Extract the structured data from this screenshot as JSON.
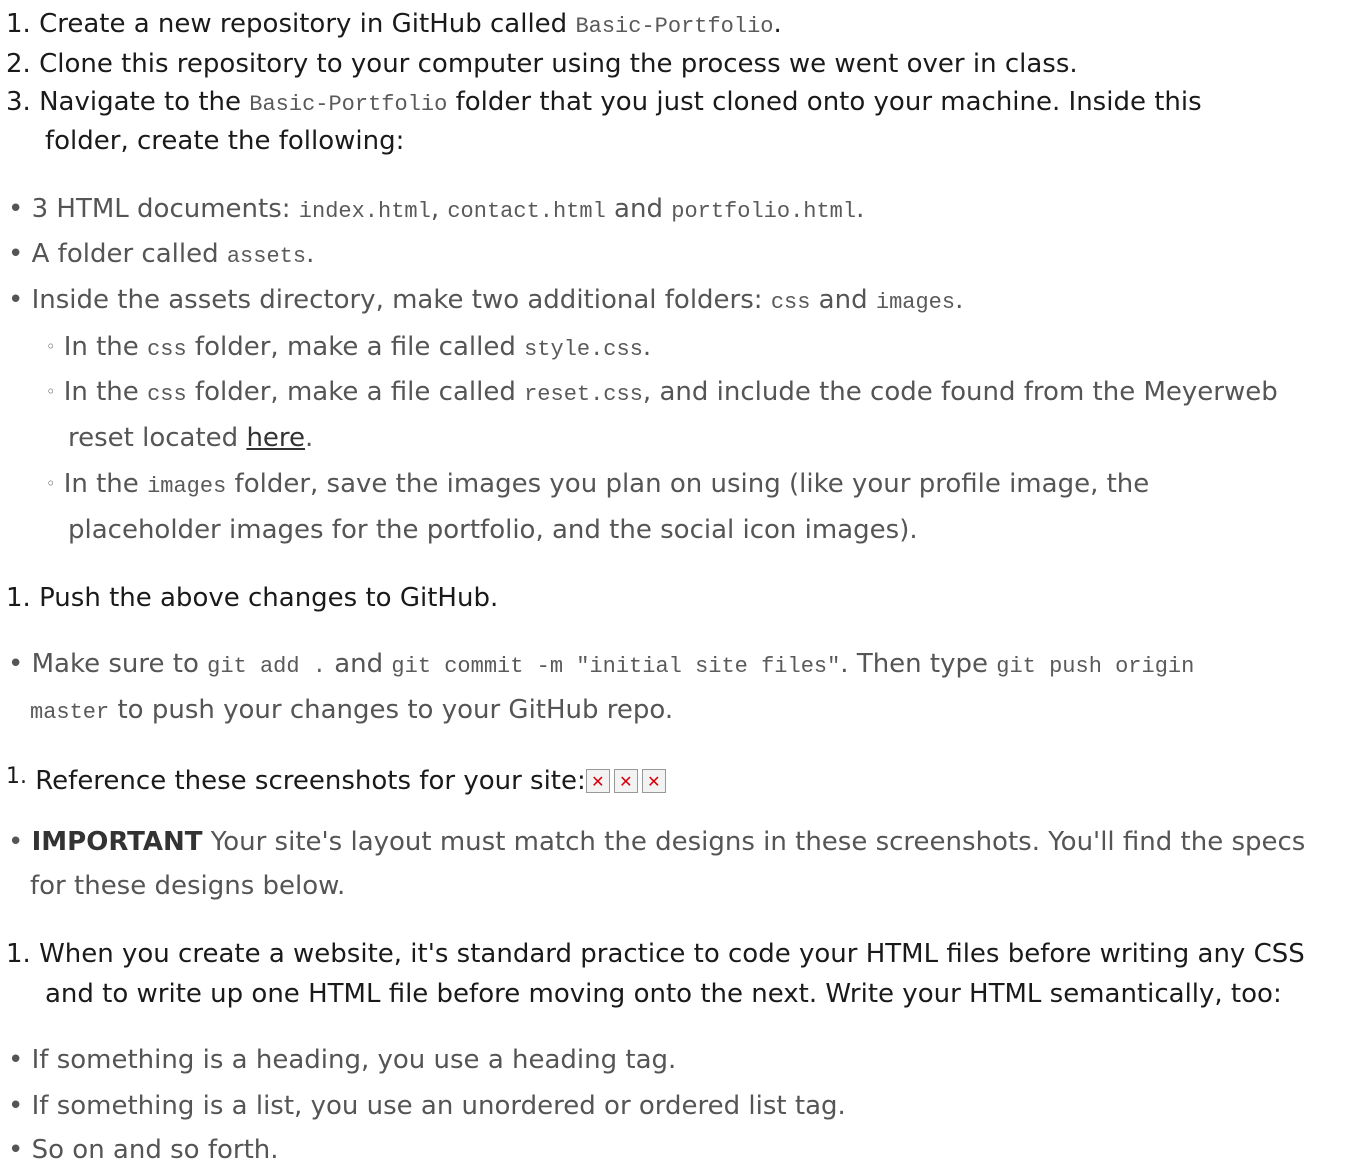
{
  "steps_a": [
    {
      "num": "1.",
      "before": "Create a new repository in GitHub called ",
      "code": "Basic-Portfolio",
      "after": "."
    },
    {
      "num": "2.",
      "text": "Clone this repository to your computer using the process we went over in class."
    },
    {
      "num": "3.",
      "before": "Navigate to the ",
      "code": "Basic-Portfolio",
      "after": " folder that you just cloned onto your machine. Inside this",
      "line2": "folder, create the following:"
    }
  ],
  "files_list": [
    {
      "before": "3 HTML documents: ",
      "code1": "index.html",
      "sep1": ", ",
      "code2": "contact.html",
      "sep2": " and ",
      "code3": "portfolio.html",
      "after": "."
    },
    {
      "before": "A folder called ",
      "code": "assets",
      "after": "."
    },
    {
      "before": "Inside the assets directory, make two additional folders: ",
      "code1": "css",
      "sep": " and ",
      "code2": "images",
      "after": "."
    }
  ],
  "sub_list": [
    {
      "before": "In the ",
      "code1": "css",
      "mid": " folder, make a file called ",
      "code2": "style.css",
      "after": "."
    },
    {
      "before": "In the ",
      "code1": "css",
      "mid": " folder, make a file called ",
      "code2": "reset.css",
      "after": ", and include the code found from the Meyerweb",
      "line2_before": "reset located ",
      "link": "here",
      "line2_after": "."
    },
    {
      "before": "In the ",
      "code1": "images",
      "after": " folder, save the images you plan on using (like your profile image, the",
      "line2": "placeholder images for the portfolio, and the social icon images)."
    }
  ],
  "step_push": {
    "num": "1.",
    "text": "Push the above changes to GitHub."
  },
  "push_bullet": {
    "before": "Make sure to ",
    "code1": "git add .",
    "mid": " and ",
    "code2": "git commit -m \"initial site files\"",
    "mid2": ". Then type ",
    "code3": "git push origin",
    "code4": "master",
    "after": " to push your changes to your GitHub repo."
  },
  "step_ref": {
    "num": "1.",
    "text": "Reference these screenshots for your site:",
    "broken_icon": "broken-image-icon"
  },
  "important_bullet": {
    "bold": "IMPORTANT",
    "text": " Your site's layout must match the designs in these screenshots. You'll find the specs",
    "line2": "for these designs below."
  },
  "step_html": {
    "num": "1.",
    "line1": "When you create a website, it's standard practice to code your HTML files before writing any CSS",
    "line2": "and to write up one HTML file before moving onto the next. Write your HTML semantically, too:"
  },
  "semantic_list": [
    "If something is a heading, you use a heading tag.",
    "If something is a list, you use an unordered or ordered list tag.",
    "So on and so forth."
  ],
  "markers": {
    "bullet": "•",
    "sub": "◦"
  }
}
